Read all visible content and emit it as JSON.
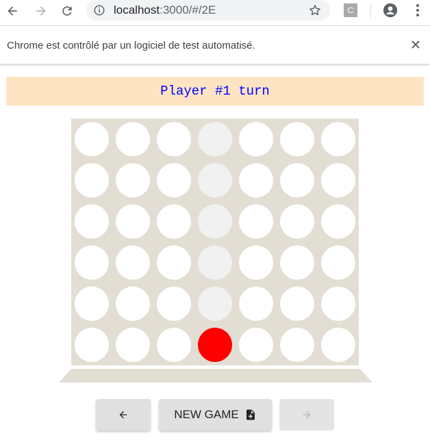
{
  "browser": {
    "url_host": "localhost",
    "url_rest": ":3000/#/2E",
    "extension_label": "C",
    "infobar_message": "Chrome est contrôlé par un logiciel de test automatisé."
  },
  "game": {
    "status_text": "Player #1 turn",
    "status_color": "#0000ff",
    "columns": 7,
    "rows": 6,
    "highlighted_column": 4,
    "board_color": "#e3ded3",
    "empty_color": "#ffffff",
    "highlight_color": "#f1f1f1",
    "player1_color": "#ff0000",
    "pieces": [
      {
        "row": 6,
        "column": 4,
        "player": 1
      }
    ]
  },
  "controls": {
    "new_game_label": "NEW GAME",
    "next_disabled": true
  }
}
